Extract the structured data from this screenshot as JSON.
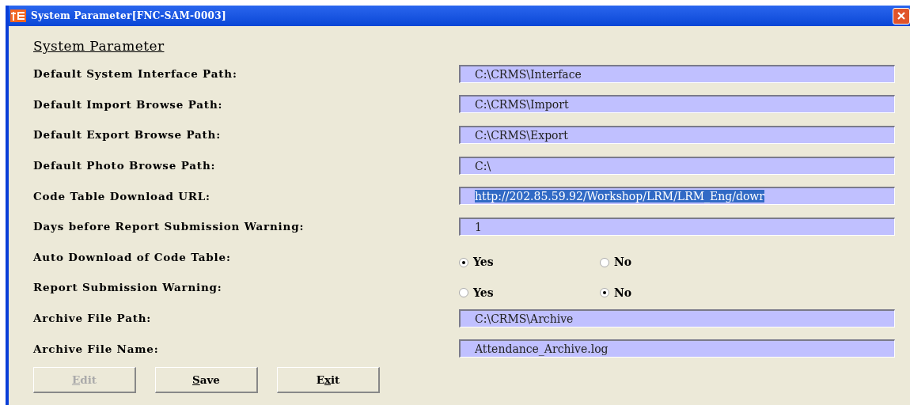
{
  "window": {
    "title": "System Parameter[FNC-SAM-0003]"
  },
  "heading": "System Parameter",
  "rows": [
    {
      "kind": "text",
      "label": "Default System Interface Path:",
      "value": "C:\\CRMS\\Interface",
      "highlighted": false
    },
    {
      "kind": "text",
      "label": "Default Import Browse Path:",
      "value": "C:\\CRMS\\Import",
      "highlighted": false
    },
    {
      "kind": "text",
      "label": "Default Export Browse Path:",
      "value": "C:\\CRMS\\Export",
      "highlighted": false
    },
    {
      "kind": "text",
      "label": "Default Photo Browse Path:",
      "value": "C:\\",
      "highlighted": false
    },
    {
      "kind": "text",
      "label": "Code Table Download URL:",
      "value": "http://202.85.59.92/Workshop/LRM/LRM_Eng/dowr",
      "highlighted": true
    },
    {
      "kind": "text",
      "label": "Days before Report Submission Warning:",
      "value": "1",
      "highlighted": false
    },
    {
      "kind": "radio",
      "label": "Auto Download of Code Table:",
      "options": [
        {
          "label": "Yes",
          "selected": true
        },
        {
          "label": "No",
          "selected": false
        }
      ]
    },
    {
      "kind": "radio",
      "label": "Report Submission Warning:",
      "options": [
        {
          "label": "Yes",
          "selected": false
        },
        {
          "label": "No",
          "selected": true
        }
      ]
    },
    {
      "kind": "text",
      "label": "Archive File Path:",
      "value": "C:\\CRMS\\Archive",
      "highlighted": false
    },
    {
      "kind": "text",
      "label": "Archive File Name:",
      "value": "Attendance_Archive.log",
      "highlighted": false
    }
  ],
  "buttons": [
    {
      "label": [
        {
          "text": "E",
          "underlined": true
        },
        {
          "text": "dit",
          "underlined": false
        }
      ],
      "disabled": true
    },
    {
      "label": [
        {
          "text": "S",
          "underlined": true
        },
        {
          "text": "ave",
          "underlined": false
        }
      ],
      "disabled": false
    },
    {
      "label": [
        {
          "text": "E",
          "underlined": false
        },
        {
          "text": "x",
          "underlined": true
        },
        {
          "text": "it",
          "underlined": false
        }
      ],
      "disabled": false
    }
  ]
}
